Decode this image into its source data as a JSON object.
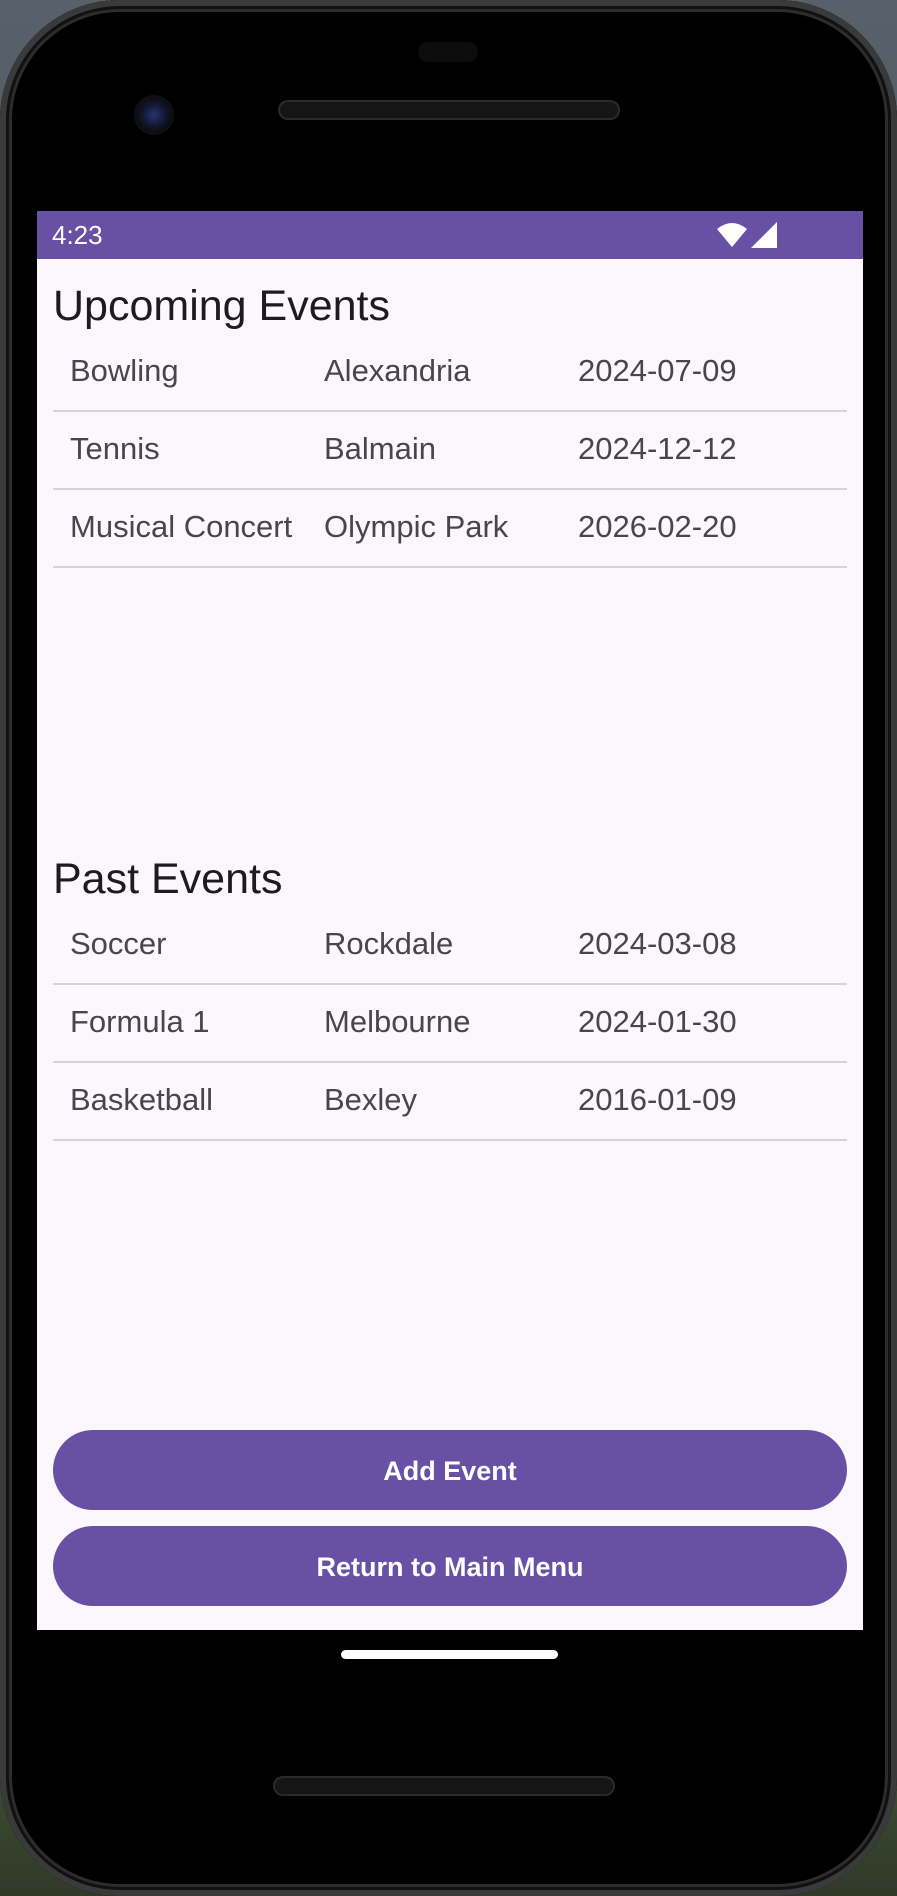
{
  "status_bar": {
    "time": "4:23",
    "wifi_icon": "wifi-icon",
    "signal_icon": "signal-icon"
  },
  "upcoming": {
    "title": "Upcoming Events",
    "events": [
      {
        "name": "Bowling",
        "location": "Alexandria",
        "date": "2024-07-09"
      },
      {
        "name": "Tennis",
        "location": "Balmain",
        "date": "2024-12-12"
      },
      {
        "name": "Musical Concert",
        "location": "Olympic Park",
        "date": "2026-02-20"
      }
    ]
  },
  "past": {
    "title": "Past Events",
    "events": [
      {
        "name": "Soccer",
        "location": "Rockdale",
        "date": "2024-03-08"
      },
      {
        "name": "Formula 1",
        "location": "Melbourne",
        "date": "2024-01-30"
      },
      {
        "name": "Basketball",
        "location": "Bexley",
        "date": "2016-01-09"
      }
    ]
  },
  "buttons": {
    "add_event": "Add Event",
    "return_main_menu": "Return to Main Menu"
  },
  "colors": {
    "primary": "#6851a4",
    "background": "#fcf7fd",
    "divider": "#d6d3d8"
  }
}
